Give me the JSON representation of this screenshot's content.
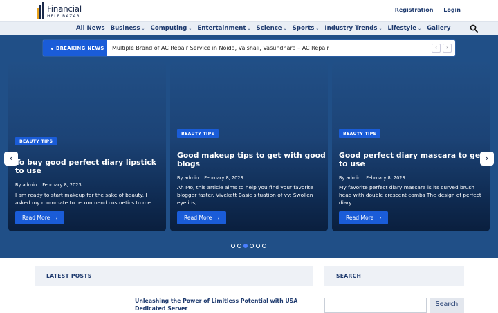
{
  "brand": {
    "line1": "Financial",
    "line2": "HELP BAZAR"
  },
  "auth": {
    "register": "Registration",
    "login": "Login"
  },
  "nav": {
    "items": [
      {
        "label": "All News",
        "chev": ""
      },
      {
        "label": "Business",
        "chev": "⌄"
      },
      {
        "label": "Computing",
        "chev": "⌄"
      },
      {
        "label": "Entertainment",
        "chev": "⌄"
      },
      {
        "label": "Science",
        "chev": "⌄"
      },
      {
        "label": "Sports",
        "chev": "⌄"
      },
      {
        "label": "Industry Trends",
        "chev": "⌄"
      },
      {
        "label": "Lifestyle",
        "chev": "⌄"
      },
      {
        "label": "Gallery",
        "chev": ""
      }
    ],
    "search_icon": "search-icon"
  },
  "ticker": {
    "label": "BREAKING NEWS",
    "text": "Multiple Brand of AC Repair Service in Noida, Vaishali, Vasundhara – AC Repair",
    "prev": "‹",
    "next": "›"
  },
  "slider": {
    "prev": "‹",
    "next": "›",
    "cards": [
      {
        "badge": "BEAUTY TIPS",
        "title": "To buy good perfect diary lipstick to use",
        "author": "By admin",
        "date": "February 8, 2023",
        "excerpt": "I am ready to start makeup for the sake of beauty. I asked my roommate to recommend cosmetics to me....",
        "cta": "Read More",
        "arrow": "›"
      },
      {
        "badge": "BEAUTY TIPS",
        "title": "Good makeup tips to get with good blogs",
        "author": "By admin",
        "date": "February 8, 2023",
        "excerpt": "Ah Mo, this article aims to help you find your favorite blogger faster. Vivekatt Basic situation of vv: Swollen eyelids,...",
        "cta": "Read More",
        "arrow": "›"
      },
      {
        "badge": "BEAUTY TIPS",
        "title": "Good perfect diary mascara to get to use",
        "author": "By admin",
        "date": "February 8, 2023",
        "excerpt": "My favorite perfect diary mascara is its curved brush head with double crescent combs The design of perfect diary...",
        "cta": "Read More",
        "arrow": "›"
      }
    ],
    "dots_total": 6,
    "active_dot": 3
  },
  "latest": {
    "heading": "LATEST POSTS",
    "first_post": "Unleashing the Power of Limitless Potential with USA Dedicated Server"
  },
  "search": {
    "heading": "SEARCH",
    "placeholder": "",
    "button": "Search"
  },
  "colors": {
    "accent": "#1a5cd8",
    "hero_bg": "#204f87",
    "nav_text": "#1e3a6e"
  }
}
